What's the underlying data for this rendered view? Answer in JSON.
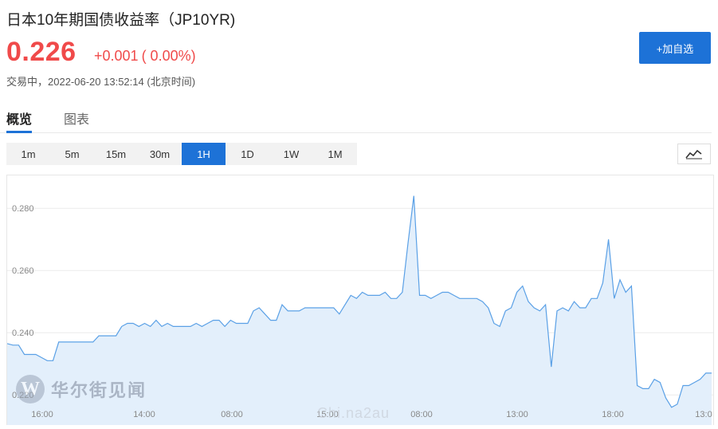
{
  "header": {
    "title": "日本10年期国债收益率（JP10YR)",
    "price": "0.226",
    "change": "+0.001",
    "change_pct": "( 0.00%)",
    "status": "交易中，",
    "datetime": "2022-06-20 13:52:14",
    "timezone": "(北京时间)",
    "add_button": "+加自选"
  },
  "tabs": [
    {
      "label": "概览",
      "active": true
    },
    {
      "label": "图表",
      "active": false
    }
  ],
  "periods": [
    {
      "label": "1m",
      "active": false
    },
    {
      "label": "5m",
      "active": false
    },
    {
      "label": "15m",
      "active": false
    },
    {
      "label": "30m",
      "active": false
    },
    {
      "label": "1H",
      "active": true
    },
    {
      "label": "1D",
      "active": false
    },
    {
      "label": "1W",
      "active": false
    },
    {
      "label": "1M",
      "active": false
    }
  ],
  "chart_toggle_icon": "line-chart-icon",
  "watermark": {
    "logo_letter": "W",
    "text": "华尔街见闻",
    "text2": "Chi.na2au"
  },
  "colors": {
    "accent": "#1d72d7",
    "up": "#f04a4a",
    "line": "#5aa0e6",
    "fill": "#e3effb"
  },
  "chart_data": {
    "type": "area",
    "yticks": [
      "0.280",
      "0.260",
      "0.240",
      "0.220"
    ],
    "xticks": [
      "16:00",
      "14:00",
      "08:00",
      "15:00",
      "08:00",
      "13:00",
      "18:00",
      "13:0"
    ],
    "ylim": [
      0.218,
      0.288
    ],
    "grid": true,
    "values": [
      0.2365,
      0.236,
      0.236,
      0.233,
      0.233,
      0.233,
      0.232,
      0.231,
      0.231,
      0.237,
      0.237,
      0.237,
      0.237,
      0.237,
      0.237,
      0.237,
      0.239,
      0.239,
      0.239,
      0.239,
      0.242,
      0.243,
      0.243,
      0.242,
      0.243,
      0.242,
      0.244,
      0.242,
      0.243,
      0.242,
      0.242,
      0.242,
      0.242,
      0.243,
      0.242,
      0.243,
      0.244,
      0.244,
      0.242,
      0.244,
      0.243,
      0.243,
      0.243,
      0.247,
      0.248,
      0.246,
      0.244,
      0.244,
      0.249,
      0.247,
      0.247,
      0.247,
      0.248,
      0.248,
      0.248,
      0.248,
      0.248,
      0.248,
      0.246,
      0.249,
      0.252,
      0.251,
      0.253,
      0.252,
      0.252,
      0.252,
      0.253,
      0.251,
      0.251,
      0.253,
      0.269,
      0.284,
      0.252,
      0.252,
      0.251,
      0.252,
      0.253,
      0.253,
      0.252,
      0.251,
      0.251,
      0.251,
      0.251,
      0.25,
      0.248,
      0.243,
      0.242,
      0.247,
      0.248,
      0.253,
      0.255,
      0.25,
      0.248,
      0.247,
      0.249,
      0.229,
      0.247,
      0.248,
      0.247,
      0.25,
      0.248,
      0.248,
      0.251,
      0.251,
      0.256,
      0.27,
      0.251,
      0.257,
      0.253,
      0.255,
      0.223,
      0.222,
      0.222,
      0.225,
      0.224,
      0.219,
      0.216,
      0.217,
      0.223,
      0.223,
      0.224,
      0.225,
      0.227,
      0.227
    ]
  }
}
